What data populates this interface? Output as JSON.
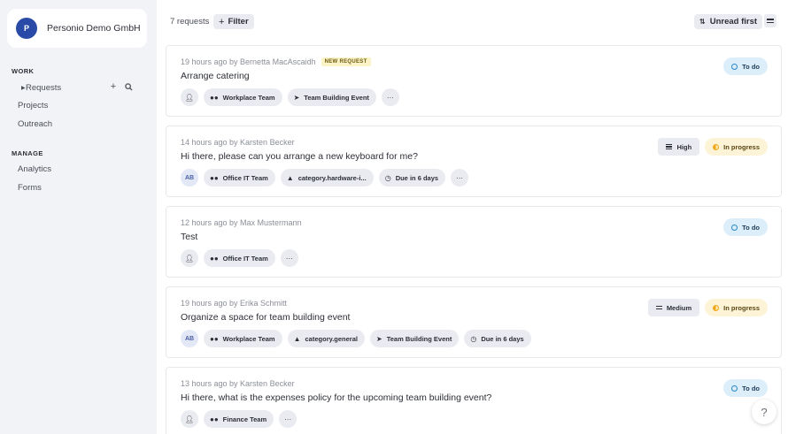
{
  "workspace": {
    "avatar": "P",
    "name": "Personio Demo GmbH"
  },
  "sidebar": {
    "work_title": "WORK",
    "manage_title": "MANAGE",
    "work_items": [
      {
        "label": "Requests",
        "icon": "caret-right-icon"
      },
      {
        "label": "Projects"
      },
      {
        "label": "Outreach"
      }
    ],
    "manage_items": [
      {
        "label": "Analytics"
      },
      {
        "label": "Forms"
      }
    ]
  },
  "toolbar": {
    "count": "7 requests",
    "filter_label": "Filter",
    "sort_label": "Unread first"
  },
  "requests": [
    {
      "meta": "19 hours ago by Bernetta MacAscaidh",
      "badge": "NEW REQUEST",
      "title": "Arrange catering",
      "assignee": "add-assignee-icon",
      "chips": [
        "Workplace Team",
        "Team Building Event"
      ],
      "status": "To do"
    },
    {
      "meta": "14 hours ago by Karsten Becker",
      "title": "Hi there, please can you arrange a new keyboard for me?",
      "assignee": "AB",
      "chips": [
        "Office IT Team",
        "category.hardware-i...",
        "Due in 6 days"
      ],
      "priority": "High",
      "status": "In progress"
    },
    {
      "meta": "12 hours ago by Max Mustermann",
      "title": "Test",
      "assignee": "add-assignee-icon",
      "chips": [
        "Office IT Team"
      ],
      "status": "To do"
    },
    {
      "meta": "19 hours ago by Erika Schmitt",
      "title": "Organize a space for team building event",
      "assignee": "AB",
      "chips": [
        "Workplace Team",
        "category.general",
        "Team Building Event",
        "Due in 6 days"
      ],
      "priority": "Medium",
      "status": "In progress"
    },
    {
      "meta": "13 hours ago by Karsten Becker",
      "title": "Hi there, what is the expenses policy for the upcoming team building event?",
      "assignee": "add-assignee-icon",
      "chips": [
        "Finance Team"
      ],
      "status": "To do"
    }
  ],
  "help": {
    "label": "?"
  },
  "colors": {
    "accent": "#2a4aa8",
    "todo_bg": "#dbeef9",
    "progress_bg": "#fdf4d8",
    "badge_bg": "#fbf3c6"
  }
}
